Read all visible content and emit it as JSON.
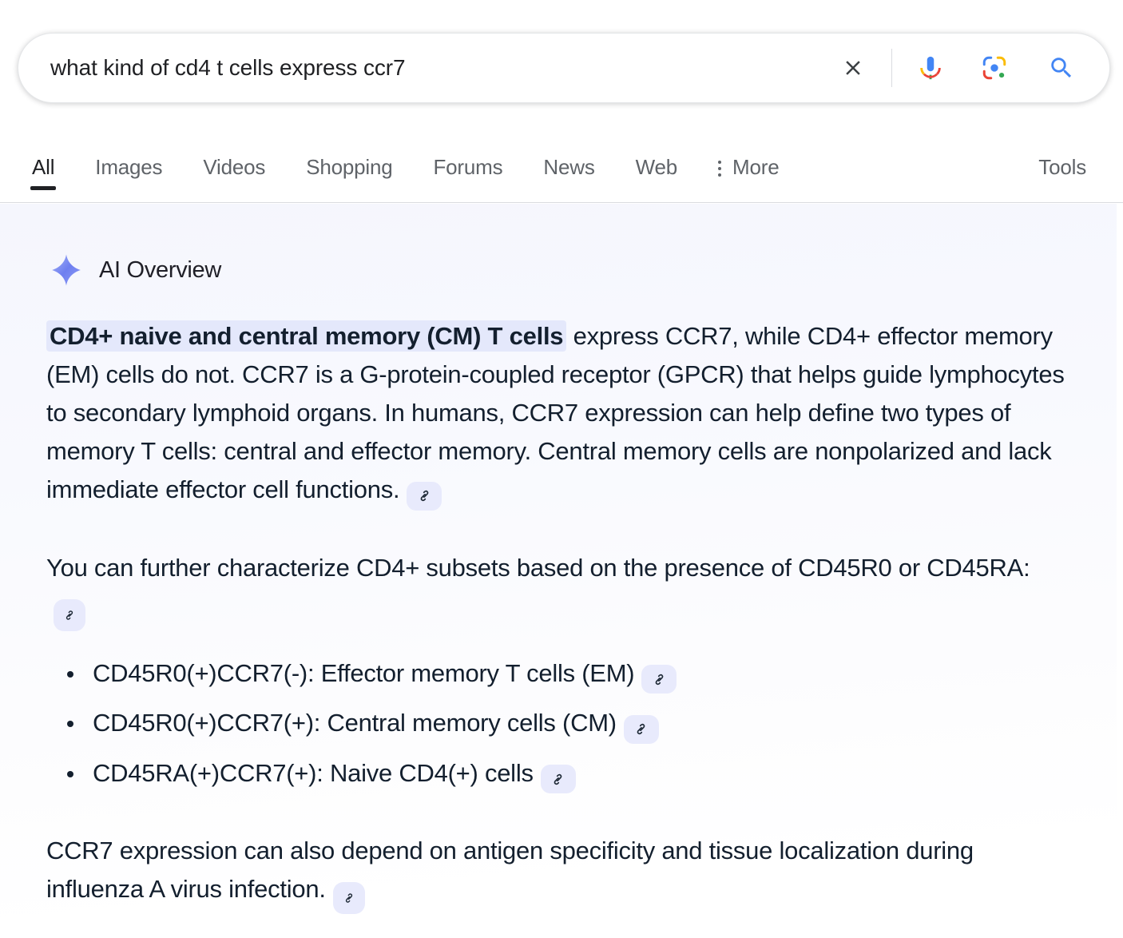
{
  "search": {
    "query": "what kind of cd4 t cells express ccr7",
    "placeholder": "Search",
    "clear_label": "Clear",
    "mic_label": "Search by voice",
    "lens_label": "Search by image",
    "search_label": "Search"
  },
  "nav": {
    "tabs": [
      {
        "label": "All",
        "active": true
      },
      {
        "label": "Images",
        "active": false
      },
      {
        "label": "Videos",
        "active": false
      },
      {
        "label": "Shopping",
        "active": false
      },
      {
        "label": "Forums",
        "active": false
      },
      {
        "label": "News",
        "active": false
      },
      {
        "label": "Web",
        "active": false
      }
    ],
    "more_label": "More",
    "tools_label": "Tools"
  },
  "ai_overview": {
    "title": "AI Overview",
    "paragraph1": {
      "highlight": "CD4+ naive and central memory (CM) T cells",
      "rest": " express CCR7, while CD4+ effector memory (EM) cells do not. CCR7 is a G-protein-coupled receptor (GPCR) that helps guide lymphocytes to secondary lymphoid organs. In humans, CCR7 expression can help define two types of memory T cells: central and effector memory. Central memory cells are nonpolarized and lack immediate effector cell functions."
    },
    "paragraph2": "You can further characterize CD4+ subsets based on the presence of CD45R0 or CD45RA:",
    "list": [
      "CD45R0(+)CCR7(-): Effector memory T cells (EM)",
      "CD45R0(+)CCR7(+): Central memory cells (CM)",
      "CD45RA(+)CCR7(+): Naive CD4(+) cells"
    ],
    "paragraph3": "CCR7 expression can also depend on antigen specificity and tissue localization during influenza A virus infection.",
    "citation_label": "Source link"
  },
  "colors": {
    "text": "#131f2e",
    "nav_inactive": "#5f6368",
    "nav_active": "#202124",
    "highlight_bg": "#e4e8fb",
    "citation_bg": "#e8eafc",
    "panel_bg": "#f5f6fd",
    "google_blue": "#4285f4",
    "google_red": "#ea4335",
    "google_yellow": "#fbbc05",
    "google_green": "#34a853"
  }
}
